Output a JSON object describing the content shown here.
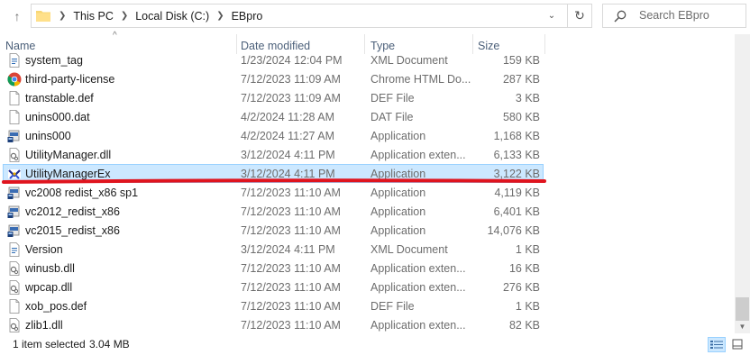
{
  "address": {
    "crumbs": [
      "This PC",
      "Local Disk (C:)",
      "EBpro"
    ]
  },
  "search": {
    "placeholder": "Search EBpro"
  },
  "columns": {
    "name": "Name",
    "date": "Date modified",
    "type": "Type",
    "size": "Size"
  },
  "files": [
    {
      "name": "system_tag",
      "date": "1/23/2024 12:04 PM",
      "type": "XML Document",
      "size": "159 KB",
      "icon": "xml-file-icon"
    },
    {
      "name": "third-party-license",
      "date": "7/12/2023 11:09 AM",
      "type": "Chrome HTML Do...",
      "size": "287 KB",
      "icon": "chrome-icon"
    },
    {
      "name": "transtable.def",
      "date": "7/12/2023 11:09 AM",
      "type": "DEF File",
      "size": "3 KB",
      "icon": "blank-file-icon"
    },
    {
      "name": "unins000.dat",
      "date": "4/2/2024 11:28 AM",
      "type": "DAT File",
      "size": "580 KB",
      "icon": "blank-file-icon"
    },
    {
      "name": "unins000",
      "date": "4/2/2024 11:27 AM",
      "type": "Application",
      "size": "1,168 KB",
      "icon": "installer-icon"
    },
    {
      "name": "UtilityManager.dll",
      "date": "3/12/2024 4:11 PM",
      "type": "Application exten...",
      "size": "6,133 KB",
      "icon": "dll-file-icon"
    },
    {
      "name": "UtilityManagerEx",
      "date": "3/12/2024 4:11 PM",
      "type": "Application",
      "size": "3,122 KB",
      "icon": "utility-app-icon",
      "selected": true
    },
    {
      "name": "vc2008 redist_x86 sp1",
      "date": "7/12/2023 11:10 AM",
      "type": "Application",
      "size": "4,119 KB",
      "icon": "installer-icon"
    },
    {
      "name": "vc2012_redist_x86",
      "date": "7/12/2023 11:10 AM",
      "type": "Application",
      "size": "6,401 KB",
      "icon": "installer-icon"
    },
    {
      "name": "vc2015_redist_x86",
      "date": "7/12/2023 11:10 AM",
      "type": "Application",
      "size": "14,076 KB",
      "icon": "installer-icon"
    },
    {
      "name": "Version",
      "date": "3/12/2024 4:11 PM",
      "type": "XML Document",
      "size": "1 KB",
      "icon": "xml-file-icon"
    },
    {
      "name": "winusb.dll",
      "date": "7/12/2023 11:10 AM",
      "type": "Application exten...",
      "size": "16 KB",
      "icon": "dll-file-icon"
    },
    {
      "name": "wpcap.dll",
      "date": "7/12/2023 11:10 AM",
      "type": "Application exten...",
      "size": "276 KB",
      "icon": "dll-file-icon"
    },
    {
      "name": "xob_pos.def",
      "date": "7/12/2023 11:10 AM",
      "type": "DEF File",
      "size": "1 KB",
      "icon": "blank-file-icon"
    },
    {
      "name": "zlib1.dll",
      "date": "7/12/2023 11:10 AM",
      "type": "Application exten...",
      "size": "82 KB",
      "icon": "dll-file-icon"
    }
  ],
  "status": {
    "count": "1 item selected",
    "selection_size": "3.04 MB"
  },
  "colors": {
    "selection_bg": "#cce8ff",
    "selection_border": "#99d1ff",
    "annotation_red": "#e0141e"
  }
}
